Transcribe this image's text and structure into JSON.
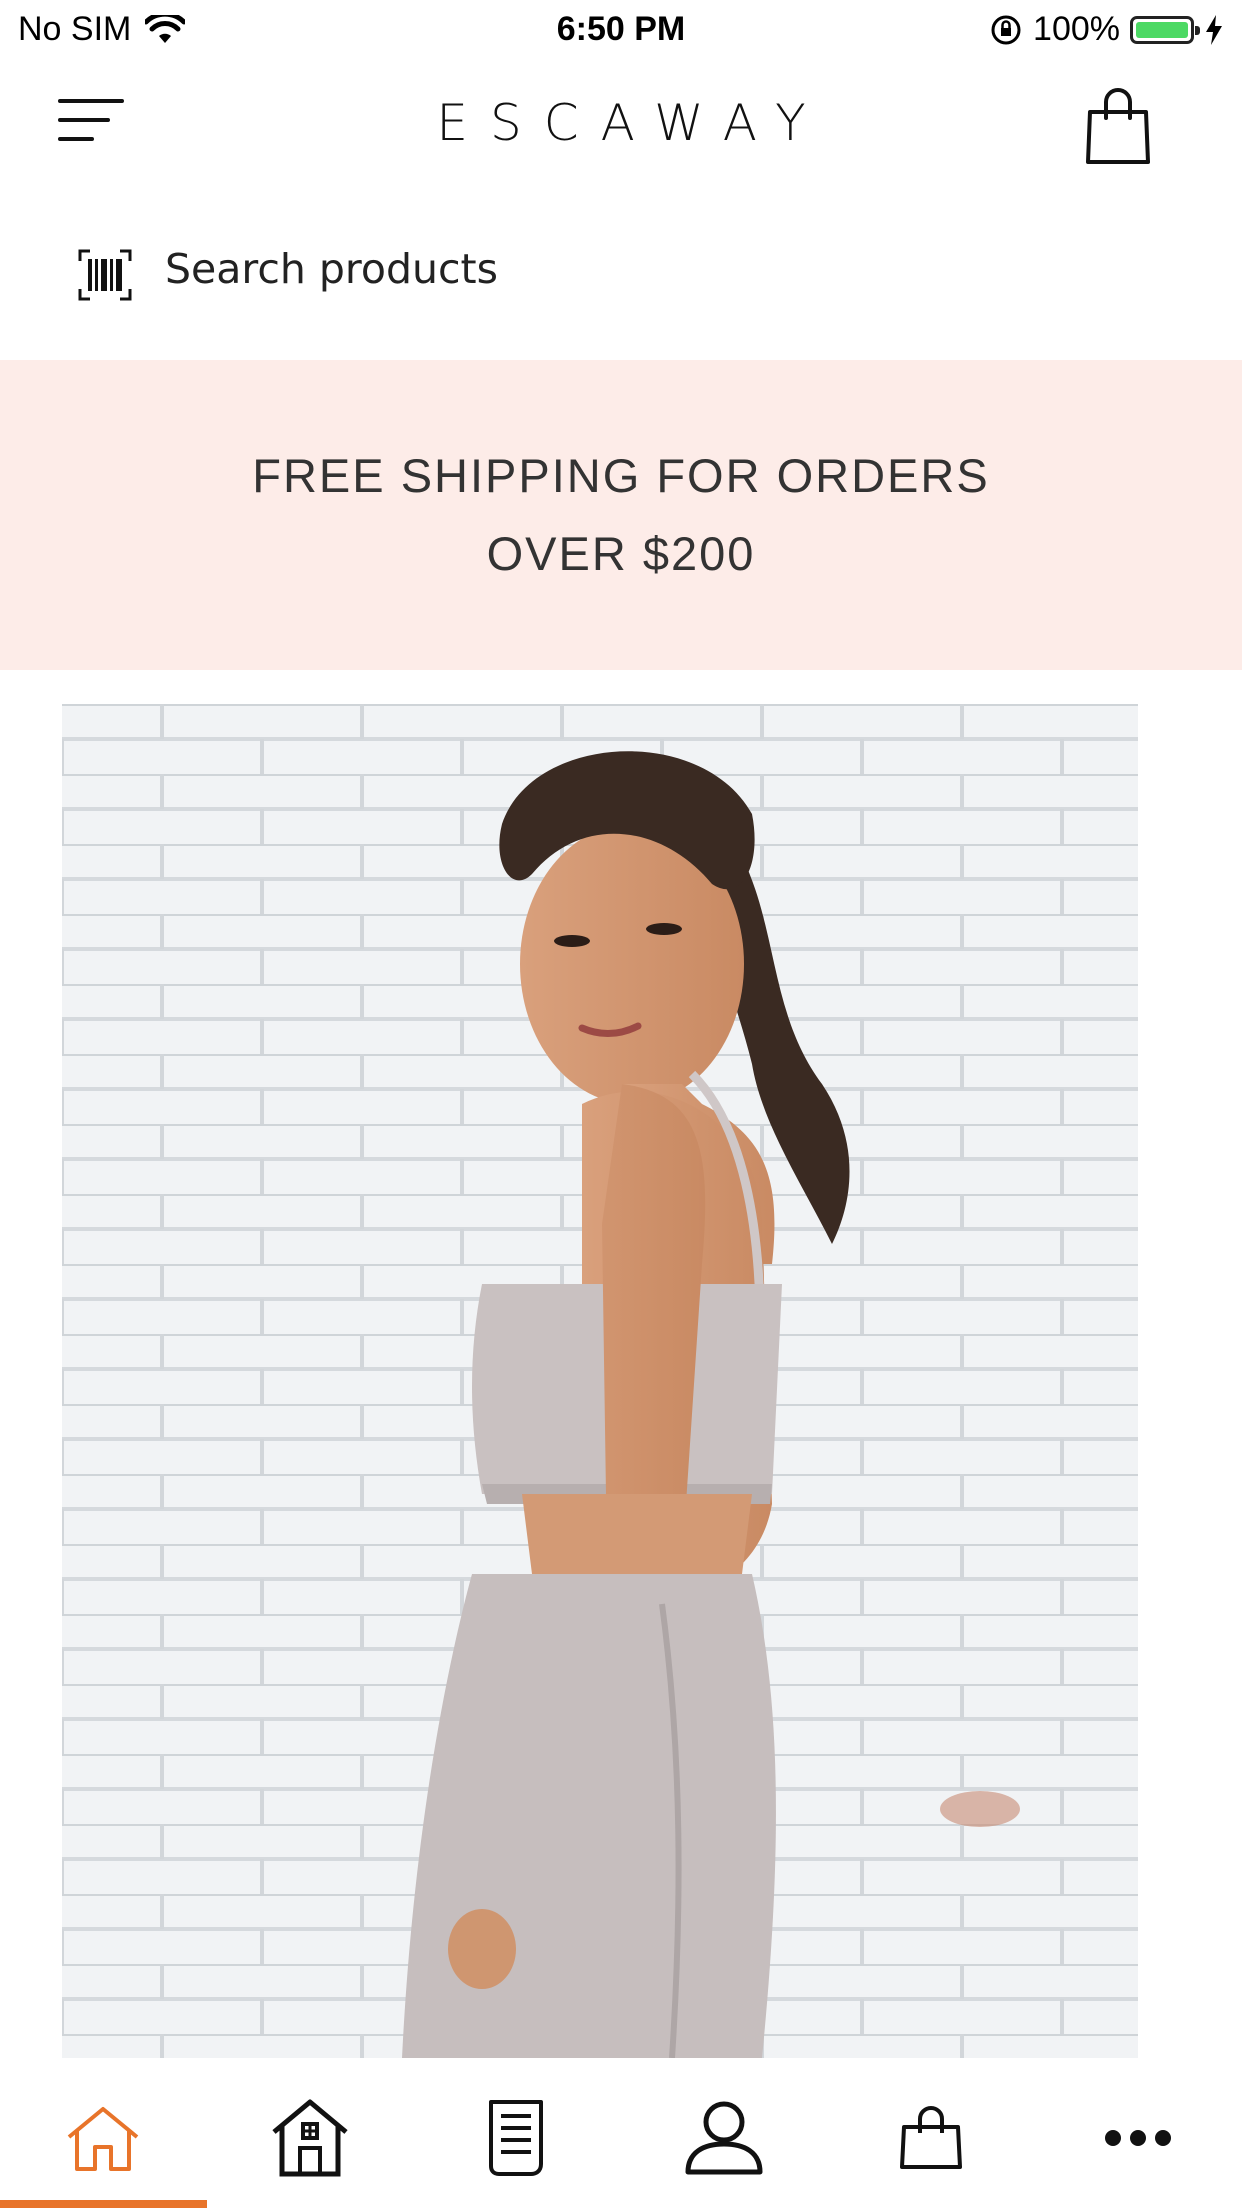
{
  "status_bar": {
    "carrier": "No SIM",
    "time": "6:50 PM",
    "battery_percent": "100%",
    "battery_level": 1.0,
    "battery_color": "#4cd964"
  },
  "header": {
    "brand": "ESCAWAY",
    "menu_icon": "hamburger-menu-icon",
    "cart_icon": "shopping-bag-icon"
  },
  "search": {
    "placeholder": "Search products",
    "icon": "barcode-scan-icon"
  },
  "banner": {
    "line1": "FREE SHIPPING FOR ORDERS",
    "line2": "OVER $200",
    "background": "#fdece8"
  },
  "hero": {
    "image": "model-in-linen-crop-top-photo"
  },
  "tabbar": {
    "active_color": "#e8742a",
    "tabs": [
      {
        "icon": "home-icon",
        "active": true
      },
      {
        "icon": "store-icon",
        "active": false
      },
      {
        "icon": "document-icon",
        "active": false
      },
      {
        "icon": "user-icon",
        "active": false
      },
      {
        "icon": "shopping-bag-icon",
        "active": false
      },
      {
        "icon": "more-icon",
        "active": false
      }
    ]
  }
}
